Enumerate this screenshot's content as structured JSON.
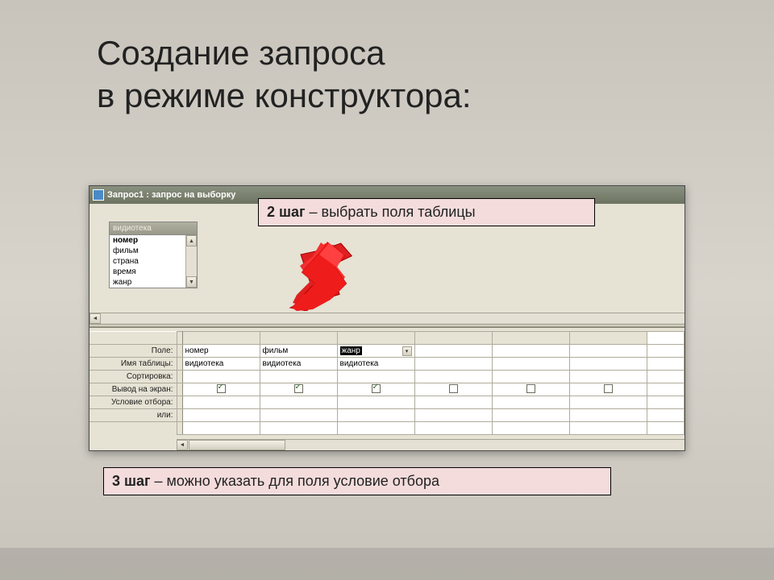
{
  "slide": {
    "title_line1": "Создание запроса",
    "title_line2": "в режиме конструктора:"
  },
  "window": {
    "title": "Запрос1 : запрос на выборку"
  },
  "field_box": {
    "header": "видиотека",
    "items": [
      "номер",
      "фильм",
      "страна",
      "время",
      "жанр"
    ]
  },
  "grid": {
    "row_labels": {
      "field": "Поле:",
      "table": "Имя таблицы:",
      "sort": "Сортировка:",
      "show": "Вывод на экран:",
      "criteria": "Условие отбора:",
      "or": "или:"
    },
    "columns": [
      {
        "field": "номер",
        "table": "видиотека",
        "show": true
      },
      {
        "field": "фильм",
        "table": "видиотека",
        "show": true
      },
      {
        "field": "жанр",
        "table": "видиотека",
        "show": true,
        "selected": true,
        "dropdown": true
      },
      {
        "field": "",
        "table": "",
        "show": false
      },
      {
        "field": "",
        "table": "",
        "show": false
      },
      {
        "field": "",
        "table": "",
        "show": false
      }
    ]
  },
  "callouts": {
    "step2_bold": "2 шаг",
    "step2_rest": " – выбрать поля таблицы",
    "step3_bold": "3 шаг",
    "step3_rest": " – можно указать для поля условие отбора"
  }
}
